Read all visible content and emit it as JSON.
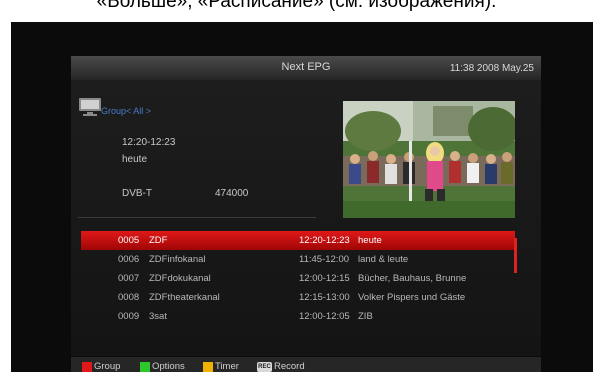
{
  "caption": "«Больше», «Расписание» (см. изображения).",
  "header": {
    "title": "Next EPG",
    "clock": "11:38 2008 May.25"
  },
  "group": "Group< All >",
  "details": {
    "time": "12:20-12:23",
    "program": "heute",
    "source": "DVB-T",
    "frequency": "474000"
  },
  "channels": [
    {
      "num": "0005",
      "name": "ZDF",
      "time": "12:20-12:23",
      "program": "heute"
    },
    {
      "num": "0006",
      "name": "ZDFinfokanal",
      "time": "11:45-12:00",
      "program": "land & leute"
    },
    {
      "num": "0007",
      "name": "ZDFdokukanal",
      "time": "12:00-12:15",
      "program": "Bücher, Bauhaus, Brunne"
    },
    {
      "num": "0008",
      "name": "ZDFtheaterkanal",
      "time": "12:15-13:00",
      "program": "Volker Pispers und Gäste"
    },
    {
      "num": "0009",
      "name": "3sat",
      "time": "12:00-12:05",
      "program": "ZIB"
    }
  ],
  "footer": {
    "group_label": "Group",
    "options_label": "Options",
    "timer_label": "Timer",
    "record_icon_text": "REC",
    "record_label": "Record"
  },
  "colors": {
    "red_key": "#e01818",
    "green_key": "#2ec82e",
    "yellow_key": "#f0b400",
    "selection": "#c80c0c",
    "group_text": "#4a7ac8"
  },
  "icons": [
    "tv-icon",
    "red-key-icon",
    "green-key-icon",
    "yellow-key-icon",
    "record-icon"
  ]
}
